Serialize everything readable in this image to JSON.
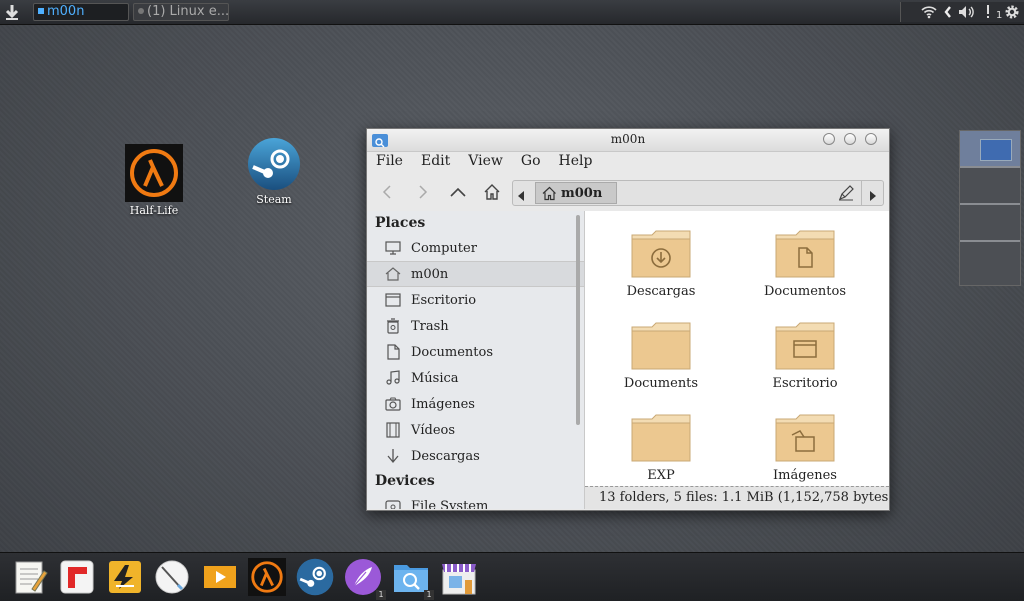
{
  "top_panel": {
    "menu_icon": "download-arrow-icon",
    "tasks": [
      {
        "label": "m00n",
        "state": "active"
      },
      {
        "label": "(1) Linux e...",
        "state": "inactive"
      }
    ],
    "tray_icons": [
      "wifi-icon",
      "chevron-left-icon",
      "volume-icon",
      "notification-icon",
      "gear-icon"
    ],
    "notification_count": "1"
  },
  "desktop": {
    "icons": [
      {
        "label": "Half-Life",
        "icon": "half-life-icon"
      },
      {
        "label": "Steam",
        "icon": "steam-icon"
      }
    ]
  },
  "window": {
    "title": "m00n",
    "menu": [
      "File",
      "Edit",
      "View",
      "Go",
      "Help"
    ],
    "path": {
      "current": "m00n"
    },
    "sidebar": {
      "places_header": "Places",
      "places": [
        {
          "label": "Computer",
          "icon": "computer-icon"
        },
        {
          "label": "m00n",
          "icon": "home-icon",
          "selected": true
        },
        {
          "label": "Escritorio",
          "icon": "desktop-folder-icon"
        },
        {
          "label": "Trash",
          "icon": "trash-icon"
        },
        {
          "label": "Documentos",
          "icon": "document-icon"
        },
        {
          "label": "Música",
          "icon": "music-icon"
        },
        {
          "label": "Imágenes",
          "icon": "camera-icon"
        },
        {
          "label": "Vídeos",
          "icon": "film-icon"
        },
        {
          "label": "Descargas",
          "icon": "download-icon"
        }
      ],
      "devices_header": "Devices",
      "devices": [
        {
          "label": "File System",
          "icon": "drive-icon"
        }
      ]
    },
    "files": [
      {
        "name": "Descargas",
        "emblem": "download"
      },
      {
        "name": "Documentos",
        "emblem": "document"
      },
      {
        "name": "Documents",
        "emblem": "none"
      },
      {
        "name": "Escritorio",
        "emblem": "desktop"
      },
      {
        "name": "EXP",
        "emblem": "none"
      },
      {
        "name": "Imágenes",
        "emblem": "pictures"
      }
    ],
    "status": "13 folders, 5 files: 1.1 MiB (1,152,758 bytes..."
  },
  "dock": {
    "apps": [
      {
        "icon": "text-editor-icon",
        "badge": ""
      },
      {
        "icon": "flipboard-icon",
        "badge": ""
      },
      {
        "icon": "inkscape-icon",
        "badge": ""
      },
      {
        "icon": "drawing-icon",
        "badge": ""
      },
      {
        "icon": "media-player-icon",
        "badge": ""
      },
      {
        "icon": "half-life-icon",
        "badge": ""
      },
      {
        "icon": "steam-icon",
        "badge": ""
      },
      {
        "icon": "feather-icon",
        "badge": "1"
      },
      {
        "icon": "file-manager-icon",
        "badge": "1"
      },
      {
        "icon": "software-store-icon",
        "badge": ""
      }
    ]
  },
  "colors": {
    "active_task": "#4fb0ff",
    "folder": "#e9c88f",
    "pager_active": "#6f7f9c"
  }
}
